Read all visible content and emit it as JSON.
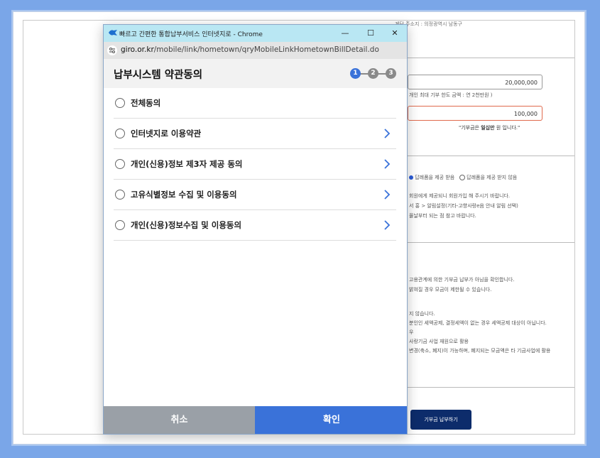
{
  "colors": {
    "accent": "#3a72d9",
    "cancel": "#9aa0a7",
    "titlebar": "#b9e7f3",
    "page_button": "#0d2c6b"
  },
  "window": {
    "title": "빠르고 간편한 통합납부서비스 인터넷지로 - Chrome",
    "minimize": "—",
    "maximize": "☐",
    "close": "✕",
    "url_host": "giro.or.kr",
    "url_path": "/mobile/link/hometown/qryMobileLinkHometownBillDetail.do"
  },
  "popup": {
    "title": "납부시스템 약관동의",
    "steps": [
      "1",
      "2",
      "3"
    ],
    "active_step": 1,
    "items": [
      {
        "label": "전체동의",
        "has_arrow": false
      },
      {
        "label": "인터넷지로 이용약관",
        "has_arrow": true
      },
      {
        "label": "개인(신용)정보 제3자 제공 동의",
        "has_arrow": true
      },
      {
        "label": "고유식별정보 수집 및 이용동의",
        "has_arrow": true
      },
      {
        "label": "개인(신용)정보수집 및 이용동의",
        "has_arrow": true
      }
    ],
    "cancel_label": "취소",
    "confirm_label": "확인"
  },
  "background_page": {
    "address_partial": "계단 주소지 : 의정광역시 남동구",
    "limit_value": "20,000,000",
    "limit_note": "개인 최대 기부 한도 금액 : 연 2천만원 )",
    "amount_value": "100,000",
    "amount_note_prefix": "\"기부금은 ",
    "amount_note_bold": "일십만",
    "amount_note_suffix": " 원 입니다.\"",
    "gift_option_1": "답례품을 제공 받음",
    "gift_option_2": "답례품을 제공 받지 않음",
    "notice_lines_1": [
      "회원에게 제공되니 회원가입 해 주시기 바랍니다.",
      "서 홍 > 알림설정(기타-고향사랑e음 안내 알림 선택)",
      "몰날부터 되는 점 참고 바랍니다."
    ],
    "notice_lines_2": [
      "고용관계에 의한 기부금 납부가 아님을 확인합니다.",
      " 밝혀질 경우 모금이 제한될 수 있습니다."
    ],
    "notice_lines_3": [
      "지 않습니다.",
      "분인인 세액공제, 결정세액이 없는 경우 세액공제 대상이 아닙니다.",
      "우",
      "사랑기금 사업 재원으로 활용",
      "변경(축소, 폐지)이 가능하며, 폐지되는 모금액은 타 기금사업에 활용"
    ],
    "donate_button": "기부금 납부하기"
  }
}
